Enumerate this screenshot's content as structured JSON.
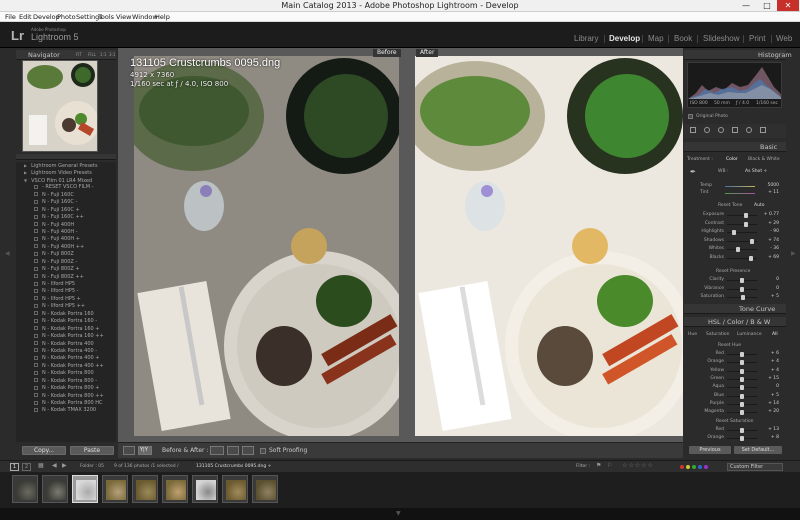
{
  "window": {
    "title": "Main Catalog 2013 - Adobe Photoshop Lightroom - Develop",
    "minimize": "—",
    "maximize": "□",
    "close": "✕"
  },
  "menu": [
    "File",
    "Edit",
    "Develop",
    "Photo",
    "Settings",
    "Tools",
    "View",
    "Window",
    "Help"
  ],
  "identity": {
    "logo": "Lr",
    "adobe": "Adobe Photoshop",
    "product": "Lightroom 5"
  },
  "modules": [
    "Library",
    "Develop",
    "Map",
    "Book",
    "Slideshow",
    "Print",
    "Web"
  ],
  "active_module": "Develop",
  "left": {
    "navigator": {
      "title": "Navigator",
      "fit": "FIT",
      "fill": "FILL",
      "ratio1": "1:1",
      "ratio2": "3:1"
    },
    "presets": [
      {
        "label": "Lightroom General Presets",
        "kind": "folder"
      },
      {
        "label": "Lightroom Video Presets",
        "kind": "folder"
      },
      {
        "label": "VSCO Film 01 LR4 Mixed",
        "kind": "folder-open"
      },
      {
        "label": "- RESET VSCO FILM -",
        "kind": "item"
      },
      {
        "label": "N - Fuji 160C",
        "kind": "item"
      },
      {
        "label": "N - Fuji 160C -",
        "kind": "item"
      },
      {
        "label": "N - Fuji 160C +",
        "kind": "item"
      },
      {
        "label": "N - Fuji 160C ++",
        "kind": "item"
      },
      {
        "label": "N - Fuji 400H",
        "kind": "item"
      },
      {
        "label": "N - Fuji 400H -",
        "kind": "item"
      },
      {
        "label": "N - Fuji 400H +",
        "kind": "item"
      },
      {
        "label": "N - Fuji 400H ++",
        "kind": "item"
      },
      {
        "label": "N - Fuji 800Z",
        "kind": "item"
      },
      {
        "label": "N - Fuji 800Z -",
        "kind": "item"
      },
      {
        "label": "N - Fuji 800Z +",
        "kind": "item"
      },
      {
        "label": "N - Fuji 800Z ++",
        "kind": "item"
      },
      {
        "label": "N - Ilford HP5",
        "kind": "item"
      },
      {
        "label": "N - Ilford HP5 -",
        "kind": "item"
      },
      {
        "label": "N - Ilford HP5 +",
        "kind": "item"
      },
      {
        "label": "N - Ilford HP5 ++",
        "kind": "item"
      },
      {
        "label": "N - Kodak Portra 160",
        "kind": "item"
      },
      {
        "label": "N - Kodak Portra 160 -",
        "kind": "item"
      },
      {
        "label": "N - Kodak Portra 160 +",
        "kind": "item"
      },
      {
        "label": "N - Kodak Portra 160 ++",
        "kind": "item"
      },
      {
        "label": "N - Kodak Portra 400",
        "kind": "item"
      },
      {
        "label": "N - Kodak Portra 400 -",
        "kind": "item"
      },
      {
        "label": "N - Kodak Portra 400 +",
        "kind": "item"
      },
      {
        "label": "N - Kodak Portra 400 ++",
        "kind": "item"
      },
      {
        "label": "N - Kodak Portra 800",
        "kind": "item"
      },
      {
        "label": "N - Kodak Portra 800 -",
        "kind": "item"
      },
      {
        "label": "N - Kodak Portra 800 +",
        "kind": "item"
      },
      {
        "label": "N - Kodak Portra 800 ++",
        "kind": "item"
      },
      {
        "label": "N - Kodak Portra 800 HC",
        "kind": "item"
      },
      {
        "label": "N - Kodak TMAX 3200",
        "kind": "item"
      }
    ],
    "copy": "Copy...",
    "paste": "Paste"
  },
  "center": {
    "before_label": "Before",
    "after_label": "After",
    "filename": "131105 Crustcrumbs 0095.dng",
    "dims": "4912 x 7360",
    "exif": "1/160 sec at ƒ / 4.0, ISO 800"
  },
  "toolbar": {
    "view_mode": "Y|Y",
    "before_after": "Before & After :",
    "soft_proofing": "Soft Proofing"
  },
  "right": {
    "histogram": {
      "title": "Histogram",
      "iso": "ISO 800",
      "focal": "50 mm",
      "aperture": "ƒ / 4.0",
      "shutter": "1/160 sec",
      "original": "Original Photo"
    },
    "basic": {
      "title": "Basic",
      "treatment": "Treatment :",
      "color": "Color",
      "bw": "Black & White",
      "wb_label": "WB :",
      "wb_value": "As Shot ÷",
      "temp_label": "Temp",
      "temp_value": "5000",
      "tint_label": "Tint",
      "tint_value": "+ 11",
      "tone_label": "Reset Tone",
      "auto": "Auto",
      "sliders": [
        {
          "label": "Exposure",
          "value": "+ 0.77",
          "pos": 0.63
        },
        {
          "label": "Contrast",
          "value": "+ 29",
          "pos": 0.62
        },
        {
          "label": "Highlights",
          "value": "- 90",
          "pos": 0.22
        },
        {
          "label": "Shadows",
          "value": "+ 74",
          "pos": 0.82
        },
        {
          "label": "Whites",
          "value": "- 36",
          "pos": 0.35
        },
        {
          "label": "Blacks",
          "value": "+ 69",
          "pos": 0.8
        }
      ],
      "presence_label": "Reset Presence",
      "presence": [
        {
          "label": "Clarity",
          "value": "0",
          "pos": 0.5
        },
        {
          "label": "Vibrance",
          "value": "0",
          "pos": 0.5
        },
        {
          "label": "Saturation",
          "value": "+ 5",
          "pos": 0.53
        }
      ]
    },
    "tone_curve": "Tone Curve",
    "hsl": {
      "title": "HSL / Color / B & W",
      "tabs": [
        "Hue",
        "Saturation",
        "Luminance",
        "All"
      ],
      "reset_hue": "Reset Hue",
      "hue": [
        {
          "label": "Red",
          "value": "+ 6"
        },
        {
          "label": "Orange",
          "value": "+ 4"
        },
        {
          "label": "Yellow",
          "value": "+ 4"
        },
        {
          "label": "Green",
          "value": "+ 15"
        },
        {
          "label": "Aqua",
          "value": "0"
        },
        {
          "label": "Blue",
          "value": "+ 5"
        },
        {
          "label": "Purple",
          "value": "+ 14"
        },
        {
          "label": "Magenta",
          "value": "+ 20"
        }
      ],
      "reset_sat": "Reset Saturation",
      "sat": [
        {
          "label": "Red",
          "value": "+ 13"
        },
        {
          "label": "Orange",
          "value": "+ 8"
        }
      ]
    },
    "previous": "Previous",
    "set_default": "Set Default..."
  },
  "filmstrip": {
    "page1": "1",
    "page2": "2",
    "source": "Folder : 05",
    "count": "9 of 136 photos /1 selected /",
    "selected_file": "131105 Crustcrumbs 0095.dng ÷",
    "filter_label": "Filter :",
    "filter_value": "Custom Filter",
    "thumbs": 9,
    "selected_index": 2
  },
  "colors": {
    "accent": "#e4e4e4",
    "panel": "#2b2b2b",
    "header": "#353535",
    "film_sel": "#9a9a9a"
  }
}
